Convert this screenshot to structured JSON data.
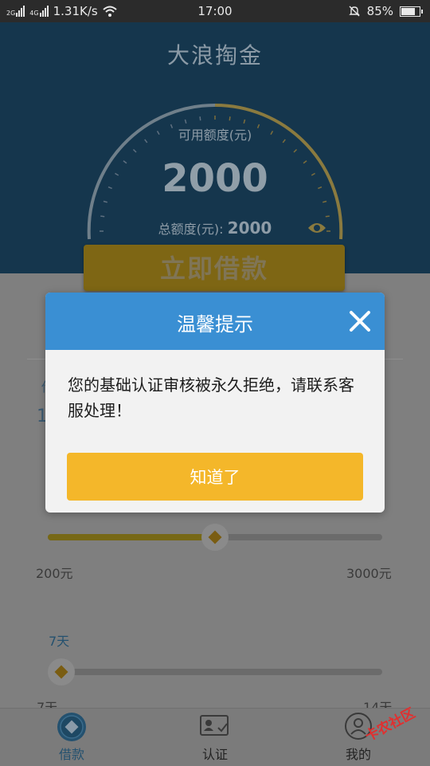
{
  "status_bar": {
    "net_tag_1": "2G",
    "net_tag_2": "4G",
    "speed": "1.31K/s",
    "time": "17:00",
    "battery": "85%",
    "battery_level": 0.85
  },
  "header": {
    "app_title": "大浪掏金",
    "available_label": "可用额度(元)",
    "available_amount": "2000",
    "total_label": "总额度(元):",
    "total_amount": "2000"
  },
  "main": {
    "borrow_button_label": "立即借款",
    "faded_left": "借",
    "faded_value": "1",
    "amount_slider": {
      "min_label": "200元",
      "max_label": "3000元",
      "level": 0.5
    },
    "days_slider": {
      "current_label": "7天",
      "min_label": "7天",
      "max_label": "14天",
      "level": 0.0
    }
  },
  "tabbar": {
    "items": [
      {
        "label": "借款",
        "icon": "loan-icon"
      },
      {
        "label": "认证",
        "icon": "id-card-icon"
      },
      {
        "label": "我的",
        "icon": "user-icon"
      }
    ]
  },
  "watermark": "卡农社区",
  "dialog": {
    "title": "温馨提示",
    "message": "您的基础认证审核被永久拒绝，请联系客服处理！",
    "confirm_label": "知道了"
  },
  "colors": {
    "dialog_header": "#3a8fd3",
    "confirm_button": "#f4b72a",
    "header_bg": "#15364d",
    "status_bar_bg": "#2b2b2b"
  }
}
